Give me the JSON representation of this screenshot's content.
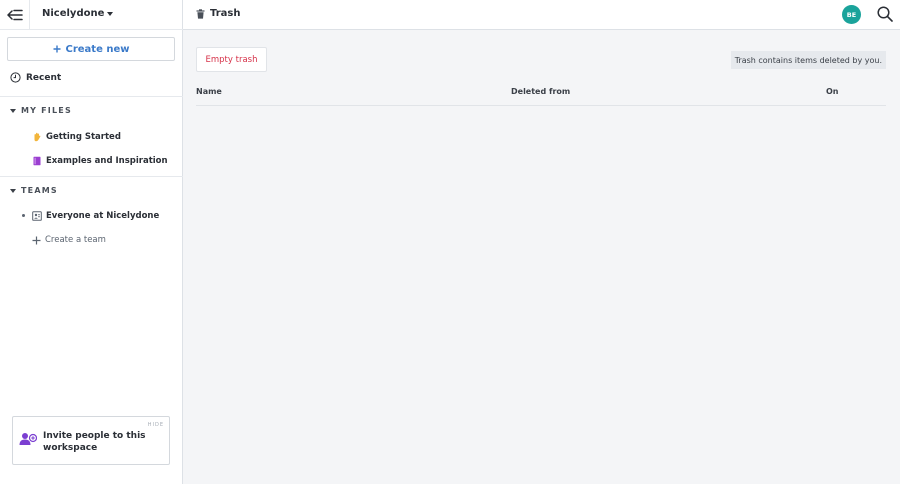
{
  "sidebar": {
    "workspace_name": "Nicelydone",
    "create_new_label": "Create new",
    "recent_label": "Recent",
    "my_files": {
      "heading": "MY FILES",
      "items": [
        {
          "label": "Getting Started",
          "icon": "waving-hand-icon"
        },
        {
          "label": "Examples and Inspiration",
          "icon": "book-icon"
        }
      ]
    },
    "teams": {
      "heading": "TEAMS",
      "items": [
        {
          "label": "Everyone at Nicelydone",
          "icon": "team-icon"
        }
      ],
      "create_team_label": "Create a team"
    },
    "invite": {
      "hide_label": "HIDE",
      "text": "Invite people to this workspace"
    }
  },
  "header": {
    "title": "Trash",
    "avatar_initials": "BE"
  },
  "main": {
    "empty_trash_label": "Empty trash",
    "notice": "Trash contains items deleted by you.",
    "columns": [
      "Name",
      "Deleted from",
      "On"
    ]
  },
  "colors": {
    "accent": "#3b7ac9",
    "danger": "#d6334a",
    "avatar": "#1aa39b",
    "background": "#f4f5f7"
  }
}
